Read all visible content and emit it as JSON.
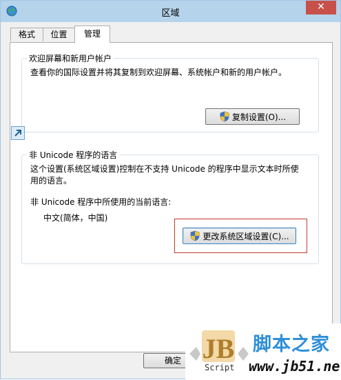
{
  "window": {
    "title": "区域",
    "close_glyph": "✕"
  },
  "tabs": [
    {
      "label": "格式",
      "active": false
    },
    {
      "label": "位置",
      "active": false
    },
    {
      "label": "管理",
      "active": true
    }
  ],
  "welcome_group": {
    "title": "欢迎屏幕和新用户帐户",
    "description": "查看你的国际设置并将其复制到欢迎屏幕、系统帐户和新的用户帐户。",
    "copy_button": "复制设置(O)..."
  },
  "unicode_group": {
    "title": "非 Unicode 程序的语言",
    "description_line1": "这个设置(系统区域设置)控制在不支持 Unicode 的程序中显示文本时所使",
    "description_line2": "用的语言。",
    "current_label": "非 Unicode 程序中所使用的当前语言:",
    "current_value": "中文(简体，中国)",
    "change_button": "更改系统区域设置(C)..."
  },
  "footer": {
    "ok_label": "确定"
  },
  "watermark": {
    "logo_text": "JB",
    "script_label": "Script",
    "site_title": "脚本之家",
    "site_url": "www.jb51.net"
  },
  "icons": {
    "app": "globe-icon",
    "shield": "uac-shield-icon",
    "expand": "expand-arrow-icon"
  },
  "colors": {
    "titlebar": "#b5d3ea",
    "close_button": "#c7504b",
    "highlight_border": "#c0392b",
    "watermark_title": "#2f8fd8"
  }
}
